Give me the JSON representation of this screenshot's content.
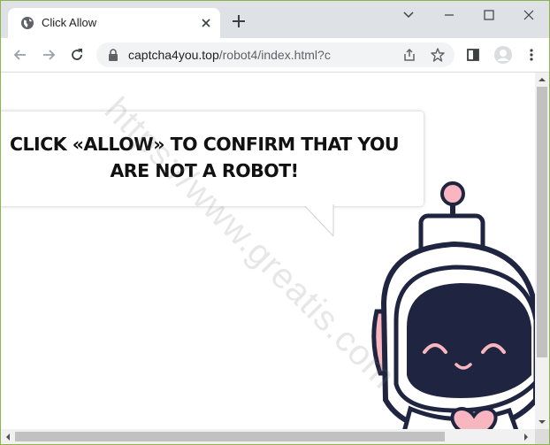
{
  "browser": {
    "tab": {
      "title": "Click Allow",
      "favicon": "globe-icon"
    },
    "new_tab_icon": "plus-icon",
    "window_controls": [
      "tab-search",
      "minimize",
      "maximize",
      "close"
    ],
    "address_bar": {
      "lock_icon": "lock-icon",
      "url_host": "captcha4you.top",
      "url_path": "/robot4/index.html?c"
    },
    "toolbar_icons": [
      "back-icon",
      "forward-icon",
      "reload-icon",
      "share-icon",
      "bookmark-star-icon",
      "side-panel-icon",
      "profile-icon",
      "menu-icon"
    ]
  },
  "page": {
    "message_line1": "CLICK «ALLOW» TO CONFIRM THAT YOU",
    "message_line2": "ARE NOT A ROBOT!",
    "watermark": "https://www.greatis.com",
    "colors": {
      "robot_outline": "#1f2440",
      "robot_pink": "#f8b7c0",
      "robot_face": "#1f2440",
      "robot_body": "#ffffff"
    }
  }
}
